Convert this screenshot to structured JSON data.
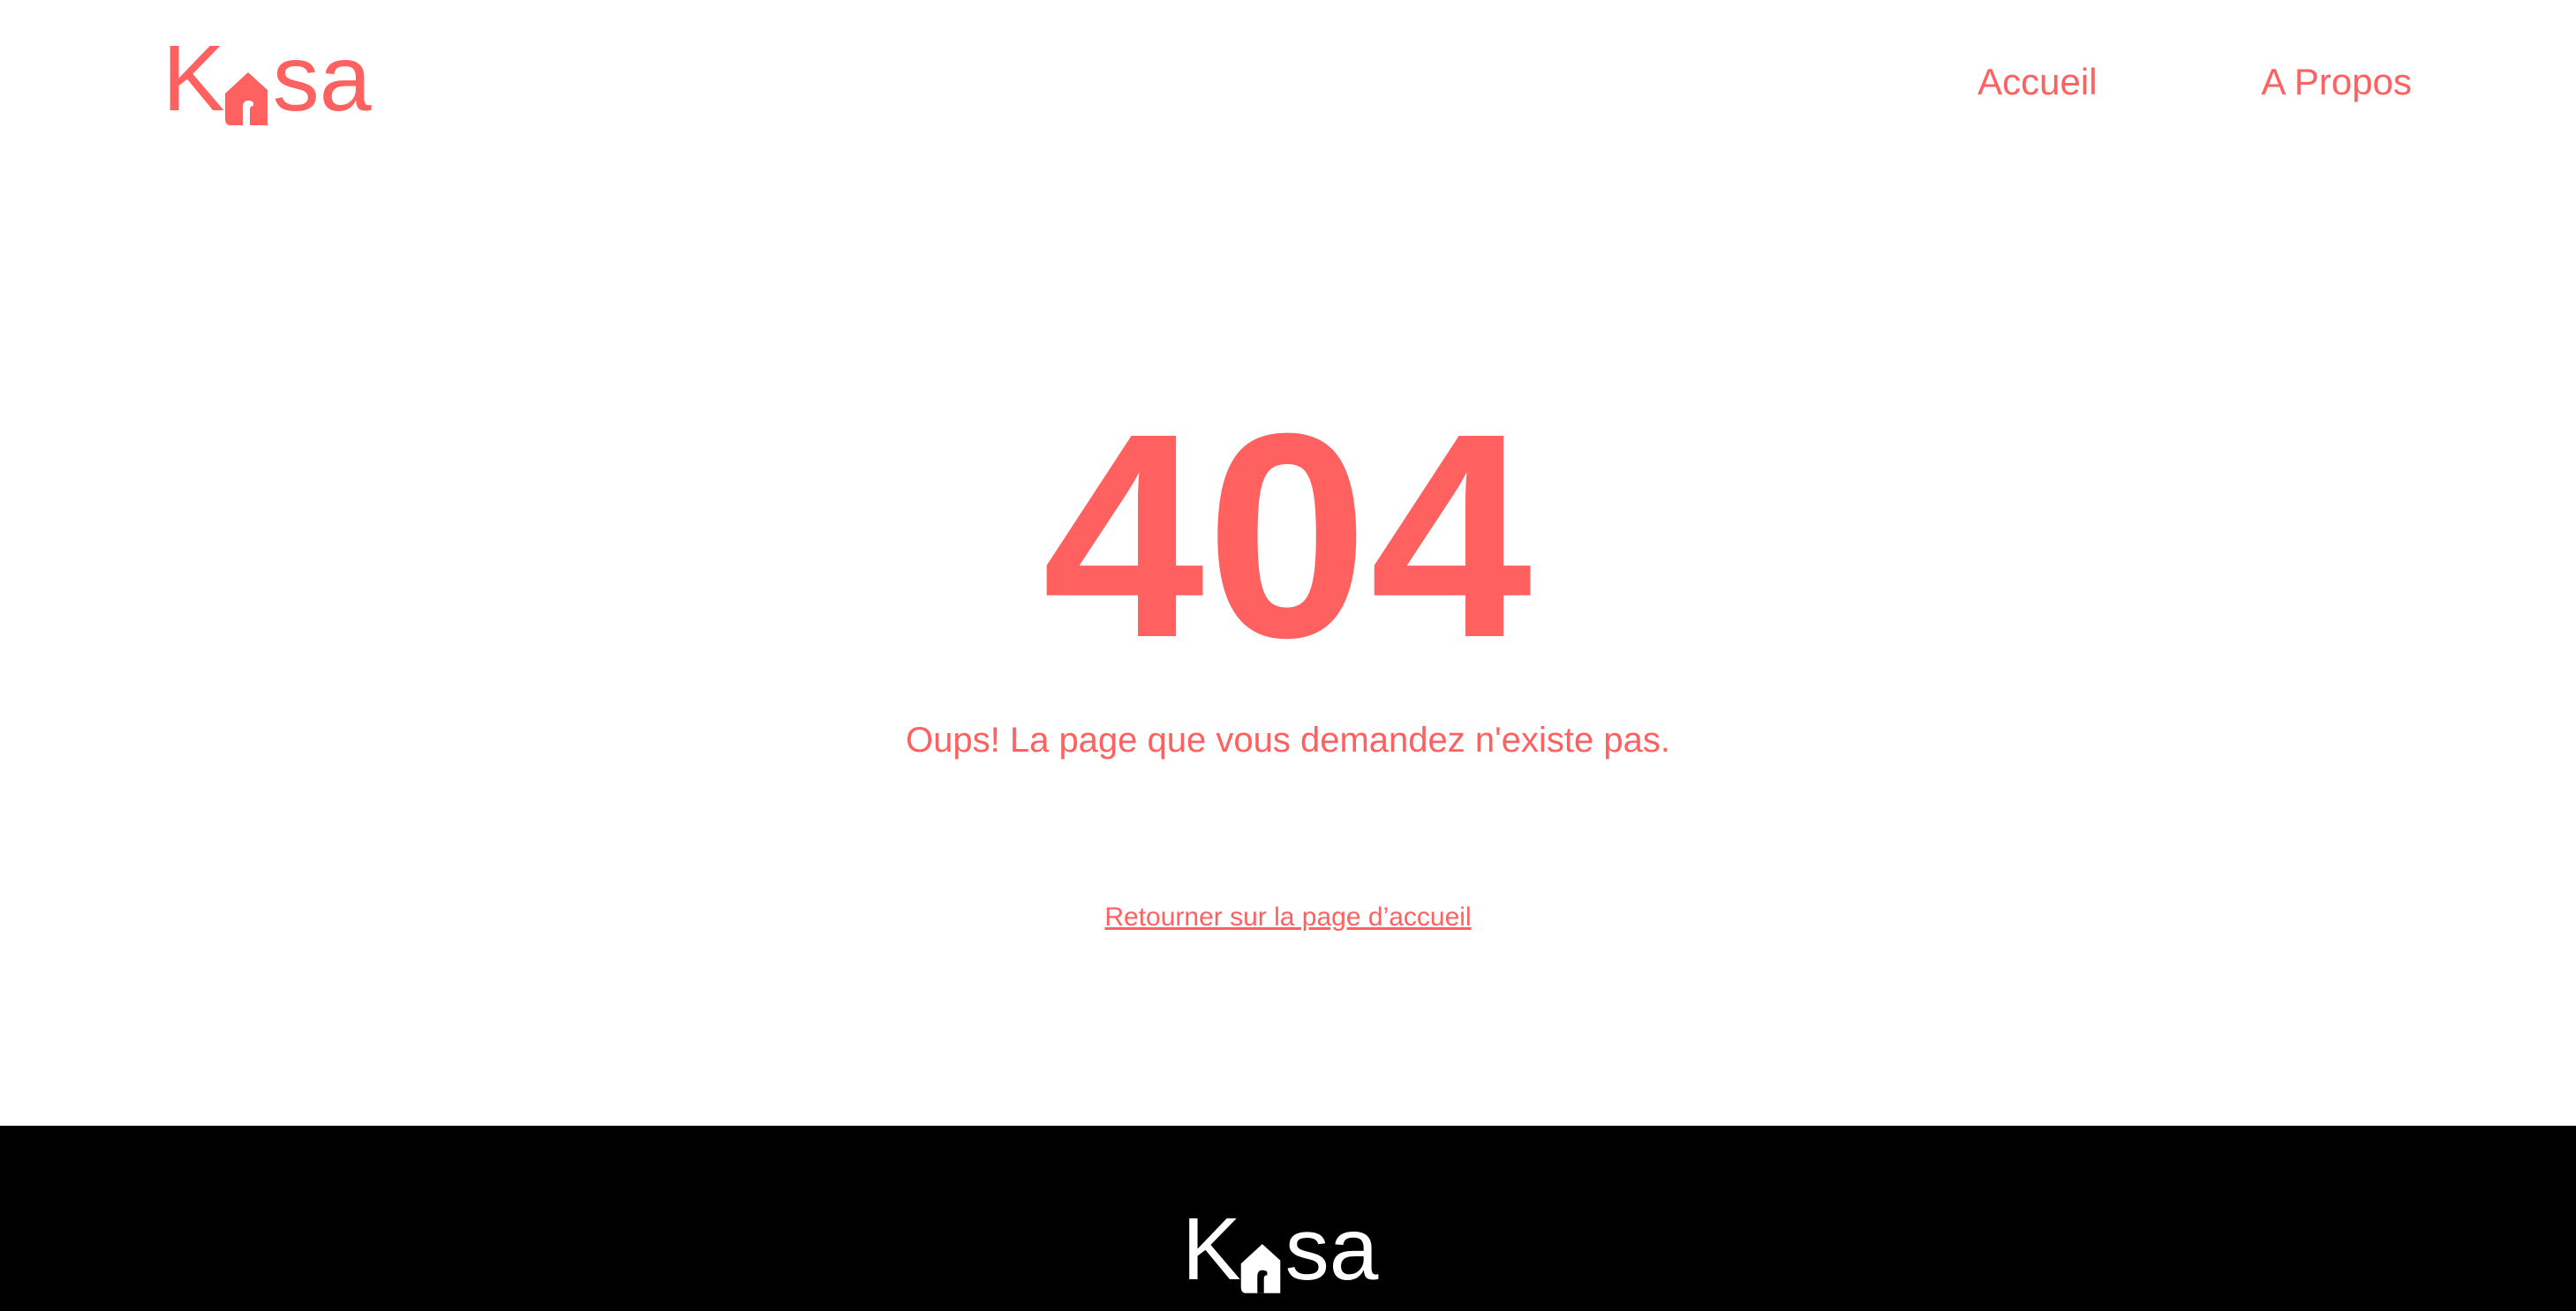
{
  "brand": {
    "logo_text_start": "K",
    "logo_text_end": "sa",
    "logo_icon": "house-icon",
    "color": "#FF6060"
  },
  "nav": {
    "items": [
      {
        "label": "Accueil"
      },
      {
        "label": "A Propos"
      }
    ]
  },
  "error": {
    "code": "404",
    "message": "Oups! La page que vous demandez n'existe pas.",
    "back_link": "Retourner sur la page d’accueil"
  },
  "footer": {
    "logo_text_start": "K",
    "logo_text_end": "sa",
    "logo_icon": "house-icon",
    "background": "#000000",
    "logo_color": "#FFFFFF"
  }
}
